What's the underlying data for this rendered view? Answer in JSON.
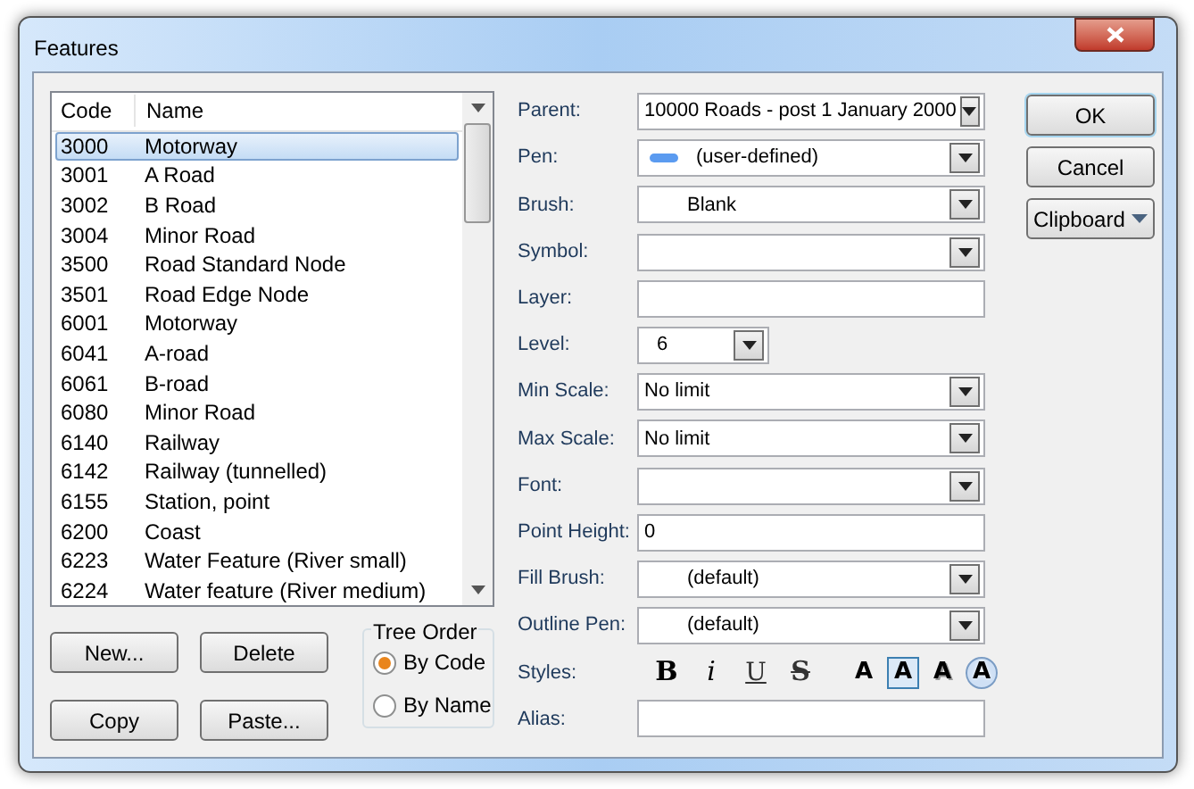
{
  "window": {
    "title": "Features"
  },
  "list": {
    "columns": [
      "Code",
      "Name"
    ],
    "rows": [
      {
        "code": "3000",
        "name": "Motorway",
        "selected": true
      },
      {
        "code": "3001",
        "name": "A Road",
        "selected": false
      },
      {
        "code": "3002",
        "name": "B Road",
        "selected": false
      },
      {
        "code": "3004",
        "name": "Minor Road",
        "selected": false
      },
      {
        "code": "3500",
        "name": "Road Standard Node",
        "selected": false
      },
      {
        "code": "3501",
        "name": "Road Edge Node",
        "selected": false
      },
      {
        "code": "6001",
        "name": "Motorway",
        "selected": false
      },
      {
        "code": "6041",
        "name": "A-road",
        "selected": false
      },
      {
        "code": "6061",
        "name": "B-road",
        "selected": false
      },
      {
        "code": "6080",
        "name": "Minor Road",
        "selected": false
      },
      {
        "code": "6140",
        "name": "Railway",
        "selected": false
      },
      {
        "code": "6142",
        "name": "Railway (tunnelled)",
        "selected": false
      },
      {
        "code": "6155",
        "name": "Station, point",
        "selected": false
      },
      {
        "code": "6200",
        "name": "Coast",
        "selected": false
      },
      {
        "code": "6223",
        "name": "Water Feature (River small)",
        "selected": false
      },
      {
        "code": "6224",
        "name": "Water feature (River medium)",
        "selected": false
      }
    ]
  },
  "list_buttons": [
    "New...",
    "Delete",
    "Copy",
    "Paste..."
  ],
  "tree_order": {
    "title": "Tree Order",
    "options": [
      {
        "label": "By Code",
        "selected": true
      },
      {
        "label": "By Name",
        "selected": false
      }
    ]
  },
  "fields": [
    {
      "label": "Parent:",
      "kind": "combo",
      "value": "10000 Roads - post 1 January 2000"
    },
    {
      "label": "Pen:",
      "kind": "pen",
      "value": "(user-defined)",
      "color": "#5b9bf0"
    },
    {
      "label": "Brush:",
      "kind": "combo-indent",
      "value": "Blank"
    },
    {
      "label": "Symbol:",
      "kind": "combo"
    },
    {
      "label": "Layer:",
      "kind": "text"
    },
    {
      "label": "Level:",
      "kind": "small-combo",
      "value": "6"
    },
    {
      "label": "Min Scale:",
      "kind": "combo",
      "value": "No limit"
    },
    {
      "label": "Max Scale:",
      "kind": "combo",
      "value": "No limit"
    },
    {
      "label": "Font:",
      "kind": "combo"
    },
    {
      "label": "Point Height:",
      "kind": "text",
      "value": "0"
    },
    {
      "label": "Fill Brush:",
      "kind": "combo-indent",
      "value": "(default)"
    },
    {
      "label": "Outline Pen:",
      "kind": "combo-indent",
      "value": "(default)"
    },
    {
      "label": "Styles:",
      "kind": "styles"
    },
    {
      "label": "Alias:",
      "kind": "text"
    }
  ],
  "styles": {
    "text": [
      {
        "kind": "bold",
        "label": "B"
      },
      {
        "kind": "italic",
        "label": "i"
      },
      {
        "kind": "underline",
        "label": "U"
      },
      {
        "kind": "strike",
        "label": "S"
      }
    ],
    "effects": [
      {
        "kind": "plain",
        "label": "A",
        "selected": false
      },
      {
        "kind": "box",
        "label": "A",
        "selected": true
      },
      {
        "kind": "shadow",
        "label": "A",
        "selected": false
      },
      {
        "kind": "halo",
        "label": "A",
        "selected": false
      }
    ]
  },
  "buttons": [
    {
      "label": "OK",
      "kind": "default"
    },
    {
      "label": "Cancel",
      "kind": "normal"
    },
    {
      "label": "Clipboard",
      "kind": "menu"
    }
  ]
}
